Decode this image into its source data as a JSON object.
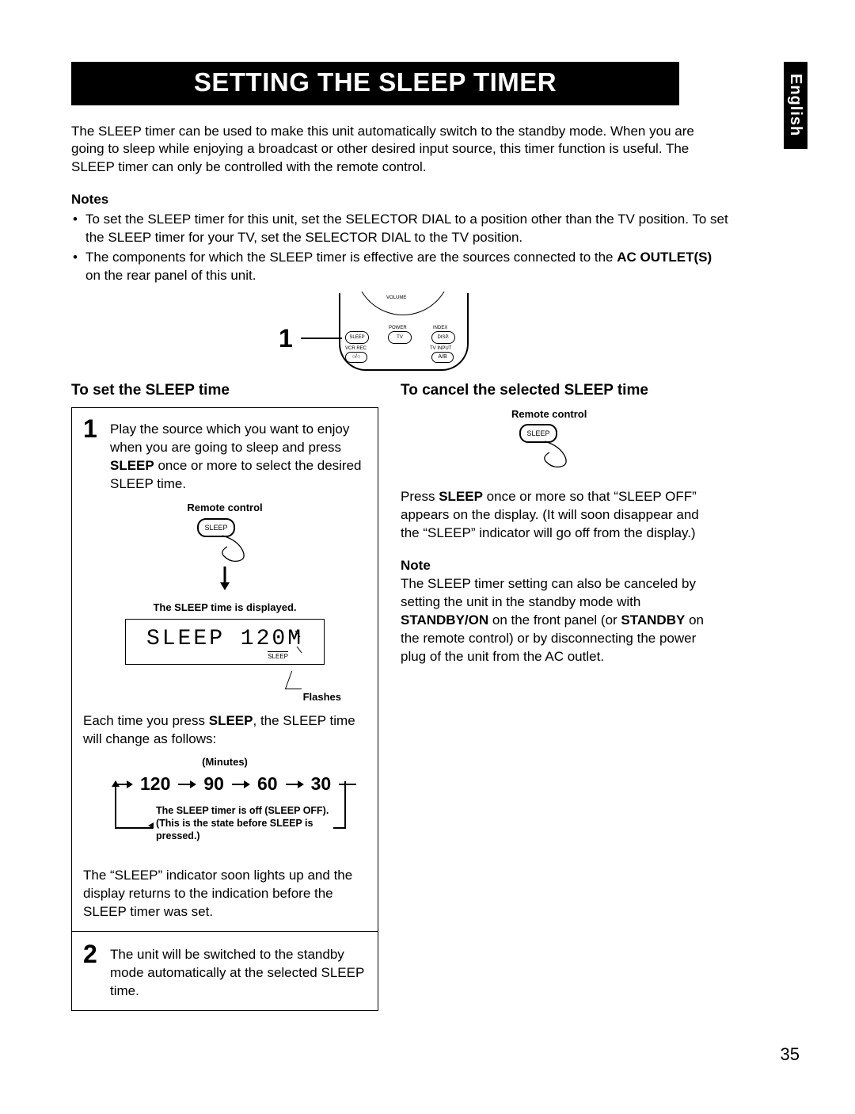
{
  "language_tab": "English",
  "title": "SETTING THE SLEEP TIMER",
  "intro": "The SLEEP timer can be used to make this unit automatically switch to the standby mode.  When you are going to sleep while enjoying a broadcast or other desired input source, this timer function is useful.  The SLEEP timer can only be controlled with the remote control.",
  "notes_label": "Notes",
  "notes": [
    "To set the SLEEP timer for this unit, set the SELECTOR DIAL to a position other than the TV position.  To set the SLEEP timer for your TV, set the SELECTOR DIAL to the TV position.",
    "The components for which the SLEEP timer is effective are the sources connected to the AC OUTLET(S) on the rear panel of this unit."
  ],
  "notes_bold_phrase": "AC OUTLET(S)",
  "remote_top": {
    "step_number": "1",
    "volume": "VOLUME",
    "sleep": "SLEEP",
    "power": "POWER",
    "tv": "TV",
    "index": "INDEX",
    "disp": "DISP.",
    "vcr_rec": "VCR REC",
    "tv_input": "TV INPUT",
    "ab": "A/B"
  },
  "left": {
    "header": "To set the SLEEP time",
    "step1_num": "1",
    "step1_a": "Play the source which you want to enjoy when you are going to sleep and press ",
    "step1_bold": "SLEEP",
    "step1_b": " once or more to select the desired SLEEP time.",
    "remote_label": "Remote control",
    "sleep_button": "SLEEP",
    "display_caption": "The SLEEP time is displayed.",
    "display_text": "SLEEP 120M",
    "display_indicator": "SLEEP",
    "flashes": "Flashes",
    "cycle_intro_a": "Each time you press ",
    "cycle_intro_bold": "SLEEP",
    "cycle_intro_b": ", the SLEEP time will change as follows:",
    "minutes_label": "(Minutes)",
    "cycle_values": [
      "120",
      "90",
      "60",
      "30"
    ],
    "off_text": "The SLEEP timer is off (SLEEP OFF). (This is the state before SLEEP is pressed.)",
    "after_cycle": "The “SLEEP” indicator soon lights up and the display returns to the indication before the SLEEP timer was set.",
    "step2_num": "2",
    "step2_text": "The unit will be switched to the standby mode automatically at the selected SLEEP time."
  },
  "right": {
    "header": "To cancel the selected SLEEP time",
    "remote_label": "Remote control",
    "sleep_button": "SLEEP",
    "body_a": "Press ",
    "body_bold": "SLEEP",
    "body_b": " once or more so that “SLEEP OFF” appears on the display.  (It will soon disappear and the “SLEEP” indicator will go off from the display.)",
    "note_label": "Note",
    "note_a": "The SLEEP timer setting can also be canceled by setting the unit in the standby mode with ",
    "note_bold1": "STANDBY/ON",
    "note_b": " on the front panel (or ",
    "note_bold2": "STANDBY",
    "note_c": " on the remote control) or by disconnecting the power plug of the unit from the AC outlet."
  },
  "page_number": "35"
}
